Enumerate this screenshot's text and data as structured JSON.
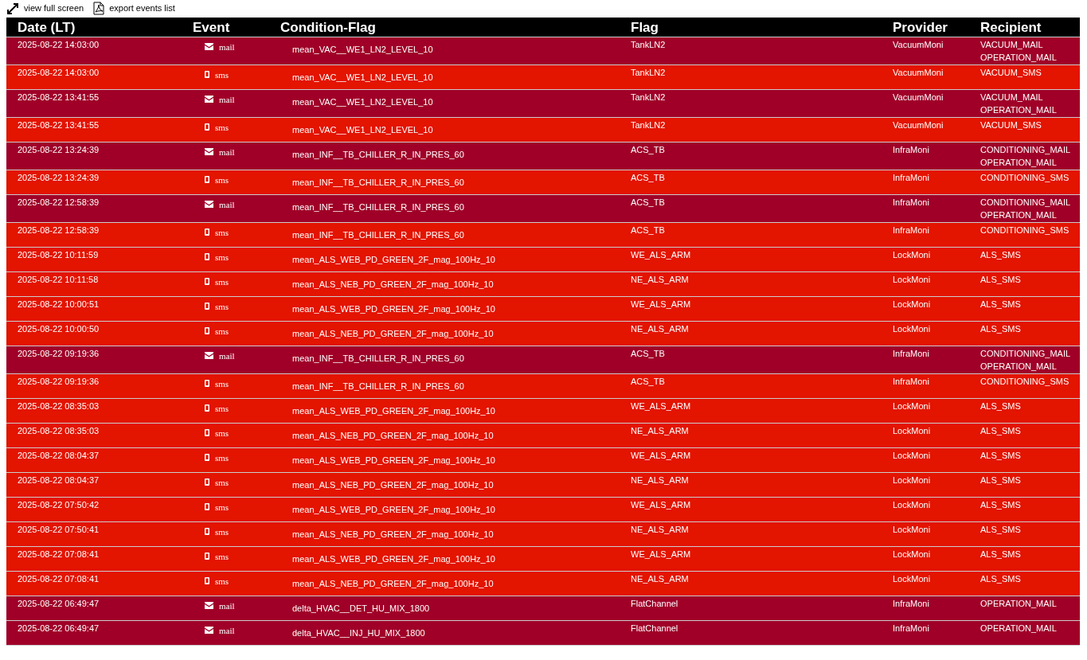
{
  "toolbar": [
    {
      "kind": "fullscreen",
      "label": "view full screen"
    },
    {
      "kind": "pdf",
      "label": "export events list"
    }
  ],
  "columns": [
    "Date (LT)",
    "Event",
    "Condition-Flag",
    "Flag",
    "Provider",
    "Recipient"
  ],
  "rows": [
    {
      "date": "2025-08-22 14:03:00",
      "event": {
        "kind": "mail",
        "label": "mail"
      },
      "condition": "mean_VAC__WE1_LN2_LEVEL_10",
      "flag": "TankLN2",
      "provider": "VacuumMoni",
      "recipients": [
        "VACUUM_MAIL",
        "OPERATION_MAIL"
      ]
    },
    {
      "date": "2025-08-22 14:03:00",
      "event": {
        "kind": "sms",
        "label": "sms"
      },
      "condition": "mean_VAC__WE1_LN2_LEVEL_10",
      "flag": "TankLN2",
      "provider": "VacuumMoni",
      "recipients": [
        "VACUUM_SMS"
      ]
    },
    {
      "date": "2025-08-22 13:41:55",
      "event": {
        "kind": "mail",
        "label": "mail"
      },
      "condition": "mean_VAC__WE1_LN2_LEVEL_10",
      "flag": "TankLN2",
      "provider": "VacuumMoni",
      "recipients": [
        "VACUUM_MAIL",
        "OPERATION_MAIL"
      ]
    },
    {
      "date": "2025-08-22 13:41:55",
      "event": {
        "kind": "sms",
        "label": "sms"
      },
      "condition": "mean_VAC__WE1_LN2_LEVEL_10",
      "flag": "TankLN2",
      "provider": "VacuumMoni",
      "recipients": [
        "VACUUM_SMS"
      ]
    },
    {
      "date": "2025-08-22 13:24:39",
      "event": {
        "kind": "mail",
        "label": "mail"
      },
      "condition": "mean_INF__TB_CHILLER_R_IN_PRES_60",
      "flag": "ACS_TB",
      "provider": "InfraMoni",
      "recipients": [
        "CONDITIONING_MAIL",
        "OPERATION_MAIL"
      ]
    },
    {
      "date": "2025-08-22 13:24:39",
      "event": {
        "kind": "sms",
        "label": "sms"
      },
      "condition": "mean_INF__TB_CHILLER_R_IN_PRES_60",
      "flag": "ACS_TB",
      "provider": "InfraMoni",
      "recipients": [
        "CONDITIONING_SMS"
      ]
    },
    {
      "date": "2025-08-22 12:58:39",
      "event": {
        "kind": "mail",
        "label": "mail"
      },
      "condition": "mean_INF__TB_CHILLER_R_IN_PRES_60",
      "flag": "ACS_TB",
      "provider": "InfraMoni",
      "recipients": [
        "CONDITIONING_MAIL",
        "OPERATION_MAIL"
      ]
    },
    {
      "date": "2025-08-22 12:58:39",
      "event": {
        "kind": "sms",
        "label": "sms"
      },
      "condition": "mean_INF__TB_CHILLER_R_IN_PRES_60",
      "flag": "ACS_TB",
      "provider": "InfraMoni",
      "recipients": [
        "CONDITIONING_SMS"
      ]
    },
    {
      "date": "2025-08-22 10:11:59",
      "event": {
        "kind": "sms",
        "label": "sms"
      },
      "condition": "mean_ALS_WEB_PD_GREEN_2F_mag_100Hz_10",
      "flag": "WE_ALS_ARM",
      "provider": "LockMoni",
      "recipients": [
        "ALS_SMS"
      ]
    },
    {
      "date": "2025-08-22 10:11:58",
      "event": {
        "kind": "sms",
        "label": "sms"
      },
      "condition": "mean_ALS_NEB_PD_GREEN_2F_mag_100Hz_10",
      "flag": "NE_ALS_ARM",
      "provider": "LockMoni",
      "recipients": [
        "ALS_SMS"
      ]
    },
    {
      "date": "2025-08-22 10:00:51",
      "event": {
        "kind": "sms",
        "label": "sms"
      },
      "condition": "mean_ALS_WEB_PD_GREEN_2F_mag_100Hz_10",
      "flag": "WE_ALS_ARM",
      "provider": "LockMoni",
      "recipients": [
        "ALS_SMS"
      ]
    },
    {
      "date": "2025-08-22 10:00:50",
      "event": {
        "kind": "sms",
        "label": "sms"
      },
      "condition": "mean_ALS_NEB_PD_GREEN_2F_mag_100Hz_10",
      "flag": "NE_ALS_ARM",
      "provider": "LockMoni",
      "recipients": [
        "ALS_SMS"
      ]
    },
    {
      "date": "2025-08-22 09:19:36",
      "event": {
        "kind": "mail",
        "label": "mail"
      },
      "condition": "mean_INF__TB_CHILLER_R_IN_PRES_60",
      "flag": "ACS_TB",
      "provider": "InfraMoni",
      "recipients": [
        "CONDITIONING_MAIL",
        "OPERATION_MAIL"
      ]
    },
    {
      "date": "2025-08-22 09:19:36",
      "event": {
        "kind": "sms",
        "label": "sms"
      },
      "condition": "mean_INF__TB_CHILLER_R_IN_PRES_60",
      "flag": "ACS_TB",
      "provider": "InfraMoni",
      "recipients": [
        "CONDITIONING_SMS"
      ]
    },
    {
      "date": "2025-08-22 08:35:03",
      "event": {
        "kind": "sms",
        "label": "sms"
      },
      "condition": "mean_ALS_WEB_PD_GREEN_2F_mag_100Hz_10",
      "flag": "WE_ALS_ARM",
      "provider": "LockMoni",
      "recipients": [
        "ALS_SMS"
      ]
    },
    {
      "date": "2025-08-22 08:35:03",
      "event": {
        "kind": "sms",
        "label": "sms"
      },
      "condition": "mean_ALS_NEB_PD_GREEN_2F_mag_100Hz_10",
      "flag": "NE_ALS_ARM",
      "provider": "LockMoni",
      "recipients": [
        "ALS_SMS"
      ]
    },
    {
      "date": "2025-08-22 08:04:37",
      "event": {
        "kind": "sms",
        "label": "sms"
      },
      "condition": "mean_ALS_WEB_PD_GREEN_2F_mag_100Hz_10",
      "flag": "WE_ALS_ARM",
      "provider": "LockMoni",
      "recipients": [
        "ALS_SMS"
      ]
    },
    {
      "date": "2025-08-22 08:04:37",
      "event": {
        "kind": "sms",
        "label": "sms"
      },
      "condition": "mean_ALS_NEB_PD_GREEN_2F_mag_100Hz_10",
      "flag": "NE_ALS_ARM",
      "provider": "LockMoni",
      "recipients": [
        "ALS_SMS"
      ]
    },
    {
      "date": "2025-08-22 07:50:42",
      "event": {
        "kind": "sms",
        "label": "sms"
      },
      "condition": "mean_ALS_WEB_PD_GREEN_2F_mag_100Hz_10",
      "flag": "WE_ALS_ARM",
      "provider": "LockMoni",
      "recipients": [
        "ALS_SMS"
      ]
    },
    {
      "date": "2025-08-22 07:50:41",
      "event": {
        "kind": "sms",
        "label": "sms"
      },
      "condition": "mean_ALS_NEB_PD_GREEN_2F_mag_100Hz_10",
      "flag": "NE_ALS_ARM",
      "provider": "LockMoni",
      "recipients": [
        "ALS_SMS"
      ]
    },
    {
      "date": "2025-08-22 07:08:41",
      "event": {
        "kind": "sms",
        "label": "sms"
      },
      "condition": "mean_ALS_WEB_PD_GREEN_2F_mag_100Hz_10",
      "flag": "WE_ALS_ARM",
      "provider": "LockMoni",
      "recipients": [
        "ALS_SMS"
      ]
    },
    {
      "date": "2025-08-22 07:08:41",
      "event": {
        "kind": "sms",
        "label": "sms"
      },
      "condition": "mean_ALS_NEB_PD_GREEN_2F_mag_100Hz_10",
      "flag": "NE_ALS_ARM",
      "provider": "LockMoni",
      "recipients": [
        "ALS_SMS"
      ]
    },
    {
      "date": "2025-08-22 06:49:47",
      "event": {
        "kind": "mail",
        "label": "mail"
      },
      "condition": "delta_HVAC__DET_HU_MIX_1800",
      "flag": "FlatChannel",
      "provider": "InfraMoni",
      "recipients": [
        "OPERATION_MAIL"
      ]
    },
    {
      "date": "2025-08-22 06:49:47",
      "event": {
        "kind": "mail",
        "label": "mail"
      },
      "condition": "delta_HVAC__INJ_HU_MIX_1800",
      "flag": "FlatChannel",
      "provider": "InfraMoni",
      "recipients": [
        "OPERATION_MAIL"
      ]
    }
  ]
}
